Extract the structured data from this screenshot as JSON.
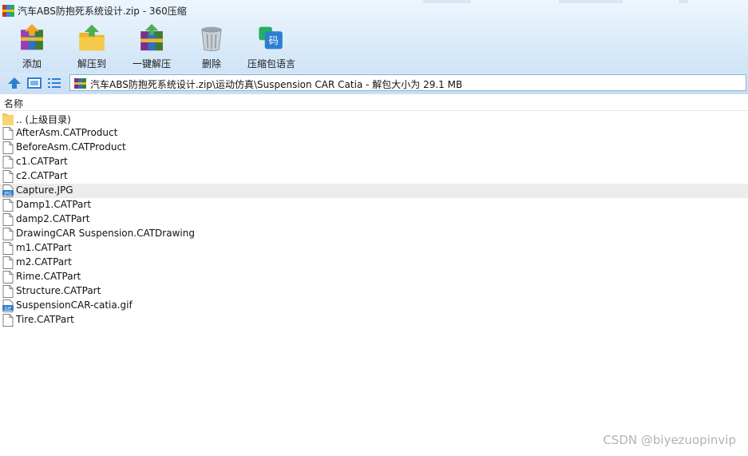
{
  "window": {
    "title": "汽车ABS防抱死系统设计.zip - 360压缩"
  },
  "toolbar": {
    "buttons": [
      {
        "label": "添加",
        "icon": "add-archive-icon"
      },
      {
        "label": "解压到",
        "icon": "extract-to-icon"
      },
      {
        "label": "一键解压",
        "icon": "one-click-extract-icon"
      },
      {
        "label": "删除",
        "icon": "trash-bin-icon"
      },
      {
        "label": "压缩包语言",
        "icon": "archive-language-icon",
        "icon_text": "码"
      }
    ]
  },
  "address": {
    "path": "汽车ABS防抱死系统设计.zip\\运动仿真\\Suspension CAR Catia - 解包大小为 29.1 MB"
  },
  "list": {
    "column_name": "名称",
    "items": [
      {
        "name": ".. (上级目录)",
        "type": "folder"
      },
      {
        "name": "AfterAsm.CATProduct",
        "type": "file"
      },
      {
        "name": "BeforeAsm.CATProduct",
        "type": "file"
      },
      {
        "name": "c1.CATPart",
        "type": "file"
      },
      {
        "name": "c2.CATPart",
        "type": "file"
      },
      {
        "name": "Capture.JPG",
        "type": "jpg",
        "badge": "JPG",
        "highlighted": true
      },
      {
        "name": "Damp1.CATPart",
        "type": "file"
      },
      {
        "name": "damp2.CATPart",
        "type": "file"
      },
      {
        "name": "DrawingCAR Suspension.CATDrawing",
        "type": "file"
      },
      {
        "name": "m1.CATPart",
        "type": "file"
      },
      {
        "name": "m2.CATPart",
        "type": "file"
      },
      {
        "name": "Rime.CATPart",
        "type": "file"
      },
      {
        "name": "Structure.CATPart",
        "type": "file"
      },
      {
        "name": "SuspensionCAR-catia.gif",
        "type": "gif",
        "badge": "GIF"
      },
      {
        "name": "Tire.CATPart",
        "type": "file"
      }
    ]
  },
  "watermark": "CSDN @biyezuopinvip",
  "colors": {
    "toolbar_bg": "#dcecfa",
    "row_highlight": "#ececec",
    "nav_blue": "#2d7fd3"
  }
}
